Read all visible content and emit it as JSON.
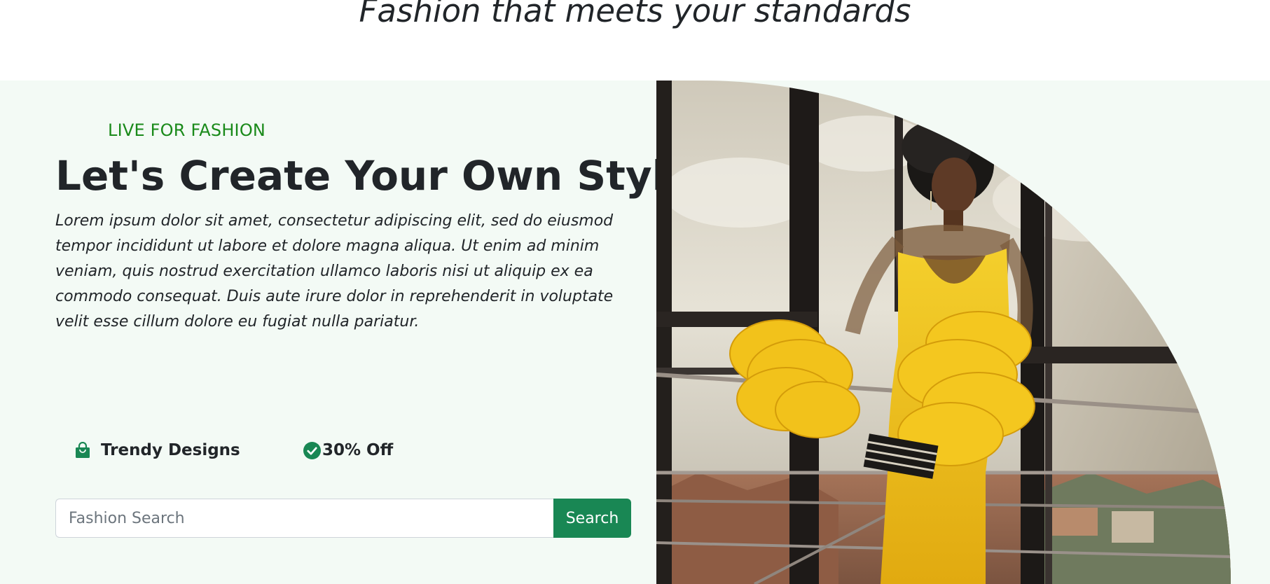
{
  "section_heading": "Fashion that meets your standards",
  "hero": {
    "eyebrow": "LIVE FOR FASHION",
    "title": "Let's Create Your Own Style",
    "description": "Lorem ipsum dolor sit amet, consectetur adipiscing elit, sed do eiusmod tempor incididunt ut labore et dolore magna aliqua. Ut enim ad minim veniam, quis nostrud exercitation ullamco laboris nisi ut aliquip ex ea commodo consequat. Duis aute irure dolor in reprehenderit in voluptate velit esse cillum dolore eu fugiat nulla pariatur.",
    "features": [
      {
        "label": "Trendy Designs",
        "icon": "shopping-bag-icon"
      },
      {
        "label": "30% Off",
        "icon": "check-circle-icon"
      }
    ],
    "search": {
      "placeholder": "Fashion Search",
      "value": "",
      "button_label": "Search"
    },
    "image": {
      "subject": "woman-in-yellow-gown-photo"
    }
  },
  "colors": {
    "accent_green": "#198754",
    "eyebrow_green": "#1a8a1a",
    "hero_background": "#f3faf5",
    "text_dark": "#212529",
    "dress_yellow": "#f2c21b"
  }
}
